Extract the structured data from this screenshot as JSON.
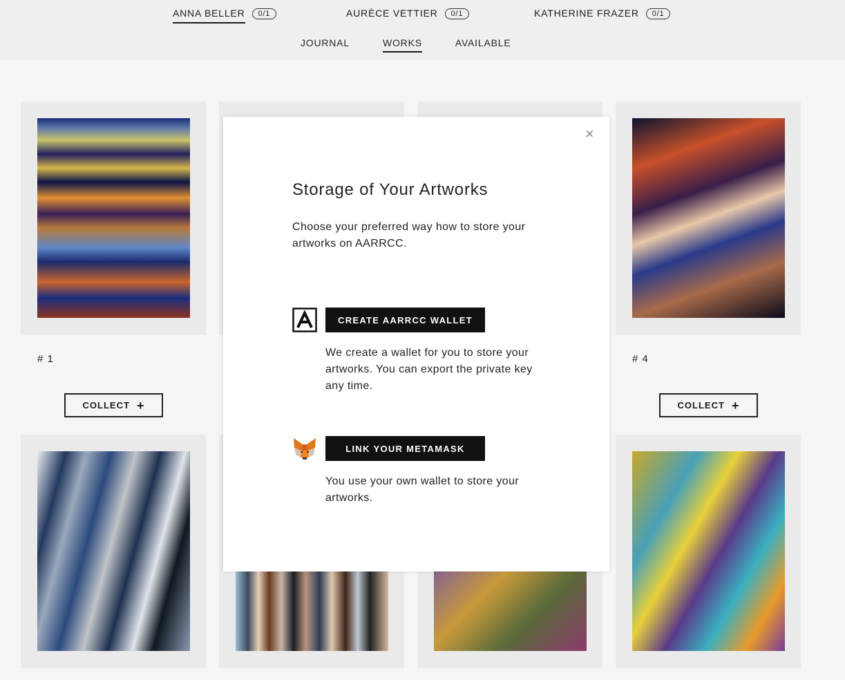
{
  "header": {
    "artists": [
      {
        "name": "ANNA BELLER",
        "count": "0/1",
        "active": true
      },
      {
        "name": "AURÈCE VETTIER",
        "count": "0/1",
        "active": false
      },
      {
        "name": "KATHERINE FRAZER",
        "count": "0/1",
        "active": false
      }
    ],
    "nav": [
      {
        "label": "JOURNAL",
        "active": false
      },
      {
        "label": "WORKS",
        "active": true
      },
      {
        "label": "AVAILABLE",
        "active": false
      }
    ]
  },
  "cards": {
    "card1": {
      "label": "# 1",
      "collect_label": "COLLECT"
    },
    "card4": {
      "label": "# 4",
      "collect_label": "COLLECT"
    },
    "plus_icon": "+"
  },
  "modal": {
    "close_icon": "×",
    "title": "Storage of Your Artworks",
    "description": "Choose your preferred way how to store your artworks on AARRCC.",
    "options": [
      {
        "button_label": "CREATE AARRCC WALLET",
        "text": "We create a wallet for you to store your artworks. You can export the private key any time.",
        "icon": "aarrcc-logo-icon"
      },
      {
        "button_label": "LINK YOUR METAMASK",
        "text": "You use your own wallet to store your artworks.",
        "icon": "metamask-fox-icon"
      }
    ]
  }
}
